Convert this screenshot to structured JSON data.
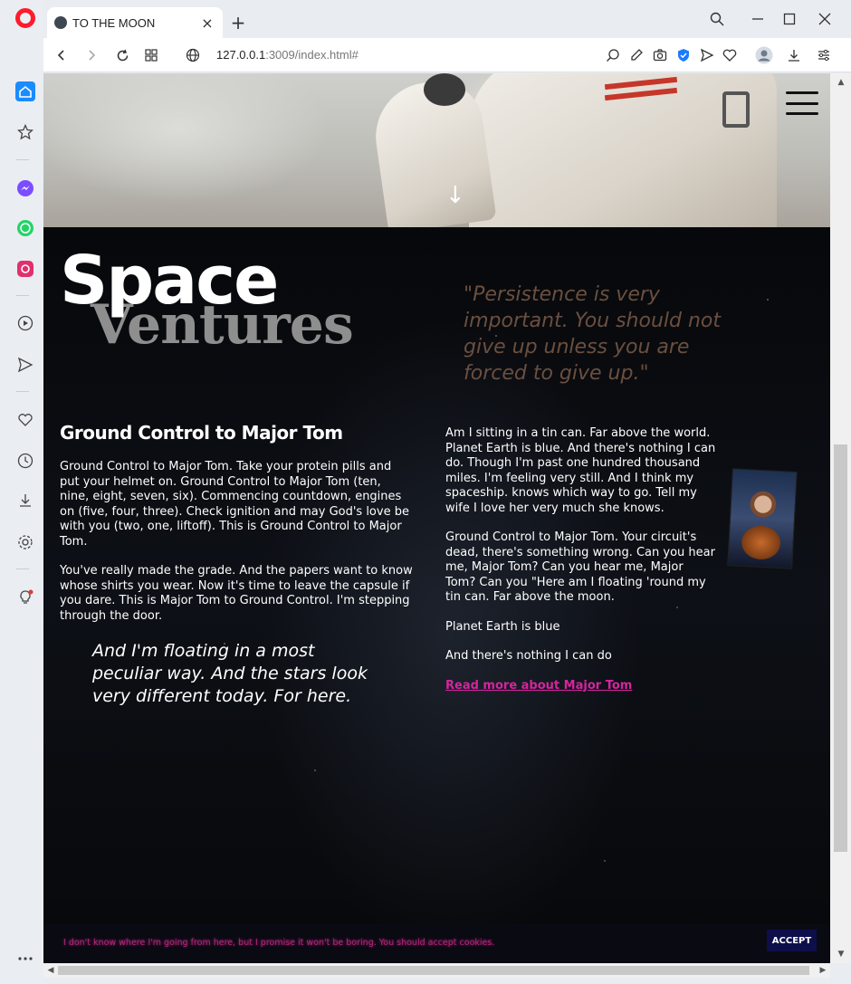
{
  "browser": {
    "tab_title": "TO THE MOON",
    "url_host": "127.0.0.1",
    "url_rest": ":3009/index.html#",
    "new_tab_symbol": "+",
    "close_symbol": "×"
  },
  "hero": {
    "arrow": "↓"
  },
  "header": {
    "title_main": "Space",
    "title_sub": "Ventures",
    "quote": "\"Persistence is very important. You should not give up unless you are forced to give up.\""
  },
  "left": {
    "heading": "Ground Control to Major Tom",
    "p1": "Ground Control to Major Tom. Take your protein pills and put your helmet on. Ground Control to Major Tom (ten, nine, eight, seven, six). Commencing countdown, engines on (five, four, three). Check ignition and may God's love be with you (two, one, liftoff). This is Ground Control to Major Tom.",
    "p2": "You've really made the grade. And the papers want to know whose shirts you wear. Now it's time to leave the capsule if you dare. This is Major Tom to Ground Control. I'm stepping through the door.",
    "pull_quote": "And I'm floating in a most peculiar way. And the stars look very different today. For here."
  },
  "right": {
    "p1": "Am I sitting in a tin can. Far above the world. Planet Earth is blue. And there's nothing I can do. Though I'm past one hundred thousand miles. I'm feeling very still. And I think my spaceship. knows which way to go. Tell my wife I love her very much she knows.",
    "p2": "Ground Control to Major Tom. Your circuit's dead, there's something wrong. Can you hear me, Major Tom? Can you hear me, Major Tom? Can you \"Here am I floating 'round my tin can. Far above the moon.",
    "p3": "Planet Earth is blue",
    "p4": "And there's nothing I can do",
    "link": "Read more about Major Tom"
  },
  "cookie": {
    "text": "I don't know where I'm going from here, but I promise it won't be boring. You should accept cookies.",
    "accept": "ACCEPT"
  },
  "colors": {
    "accent_link": "#d6249f",
    "quote": "#6b4f3f",
    "accept_bg": "#0e0f4a"
  }
}
